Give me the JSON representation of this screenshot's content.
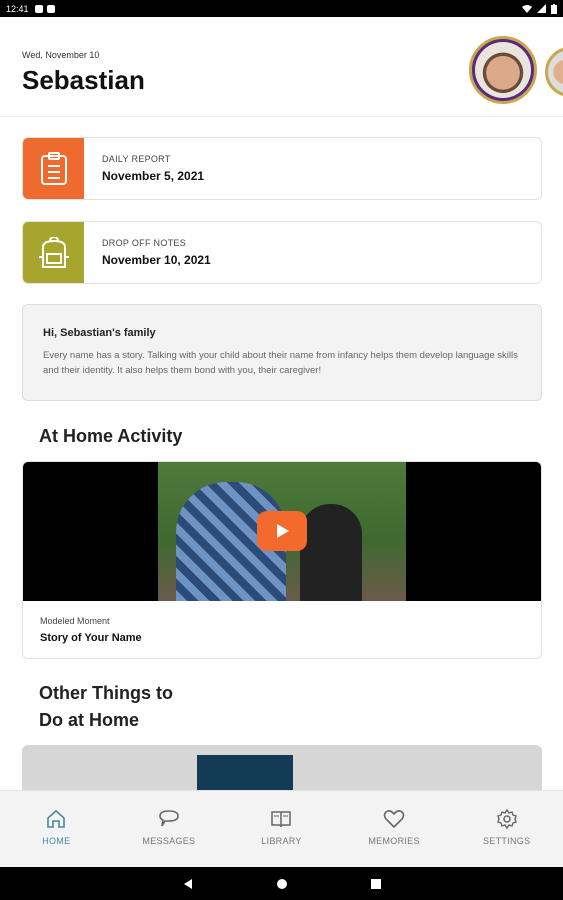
{
  "status_bar": {
    "time": "12:41"
  },
  "header": {
    "date": "Wed, November 10",
    "child_name": "Sebastian"
  },
  "cards": [
    {
      "label": "DAILY REPORT",
      "value": "November 5, 2021",
      "color": "#ef6a2e",
      "icon": "clipboard-icon"
    },
    {
      "label": "DROP OFF NOTES",
      "value": "November 10, 2021",
      "color": "#a8a52e",
      "icon": "backpack-icon"
    }
  ],
  "message": {
    "title": "Hi, Sebastian's family",
    "body": "Every name has a story. Talking with your child about their name from infancy helps them develop language skills and their identity. It also helps them bond with you, their caregiver!"
  },
  "activity": {
    "section_title": "At Home Activity",
    "video_label": "Modeled Moment",
    "video_title": "Story of Your Name",
    "play_color": "#f26a2e"
  },
  "other": {
    "section_title_line1": "Other Things to",
    "section_title_line2": "Do at Home"
  },
  "tabs": [
    {
      "label": "HOME",
      "icon": "home-icon",
      "active": true
    },
    {
      "label": "MESSAGES",
      "icon": "chat-icon",
      "active": false
    },
    {
      "label": "LIBRARY",
      "icon": "book-icon",
      "active": false
    },
    {
      "label": "MEMORIES",
      "icon": "heart-icon",
      "active": false
    },
    {
      "label": "SETTINGS",
      "icon": "gear-icon",
      "active": false
    }
  ],
  "colors": {
    "accent": "#4a8a9a",
    "avatar_ring": "#c9a84c"
  }
}
